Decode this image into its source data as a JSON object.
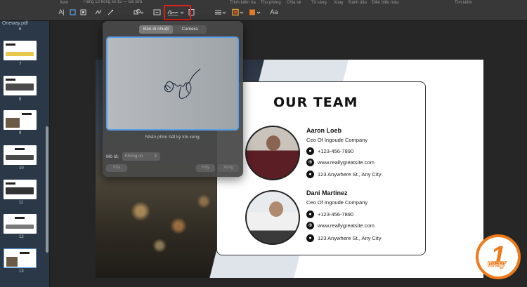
{
  "toolbar": {
    "view_label": "Xem",
    "page_info": "Trang 13 trong số 15 — Đã sửa",
    "menu": [
      "Trình kiểm tra",
      "Thu phóng",
      "Chia sẻ",
      "Tô sáng",
      "Xoay",
      "Đánh dấu",
      "Điền biểu mẫu",
      "Tìm kiếm"
    ],
    "font_label": "Aa",
    "colors": {
      "fill": "#e07b2a",
      "border": "#e0a030"
    }
  },
  "sidebar": {
    "file_name": "Oneway.pdf",
    "pages": [
      "6",
      "7",
      "8",
      "9",
      "10",
      "11",
      "12",
      "13"
    ]
  },
  "popover": {
    "tabs": [
      "Bàn di chuột",
      "Camera"
    ],
    "hint": "Nhấn phím bất kỳ khi xong.",
    "desc_label": "Mô tả:",
    "desc_value": "Không có",
    "clear_label": "Xóa",
    "cancel_label": "Hủy",
    "done_label": "Xong"
  },
  "slide": {
    "title": "OUR TEAM",
    "members": [
      {
        "name": "Aaron Loeb",
        "role": "Ceo Of Ingoude Company",
        "phone": "+123-456-7890",
        "website": "www.reallygreatsite.com",
        "address": "123 Anywhere St., Any City"
      },
      {
        "name": "Dani Martinez",
        "role": "Ceo Of Ingoude Company",
        "phone": "+123-456-7890",
        "website": "www.reallygreatsite.com",
        "address": "123 Anywhere St., Any City"
      }
    ]
  },
  "logo": {
    "number": "1",
    "text": "way"
  }
}
